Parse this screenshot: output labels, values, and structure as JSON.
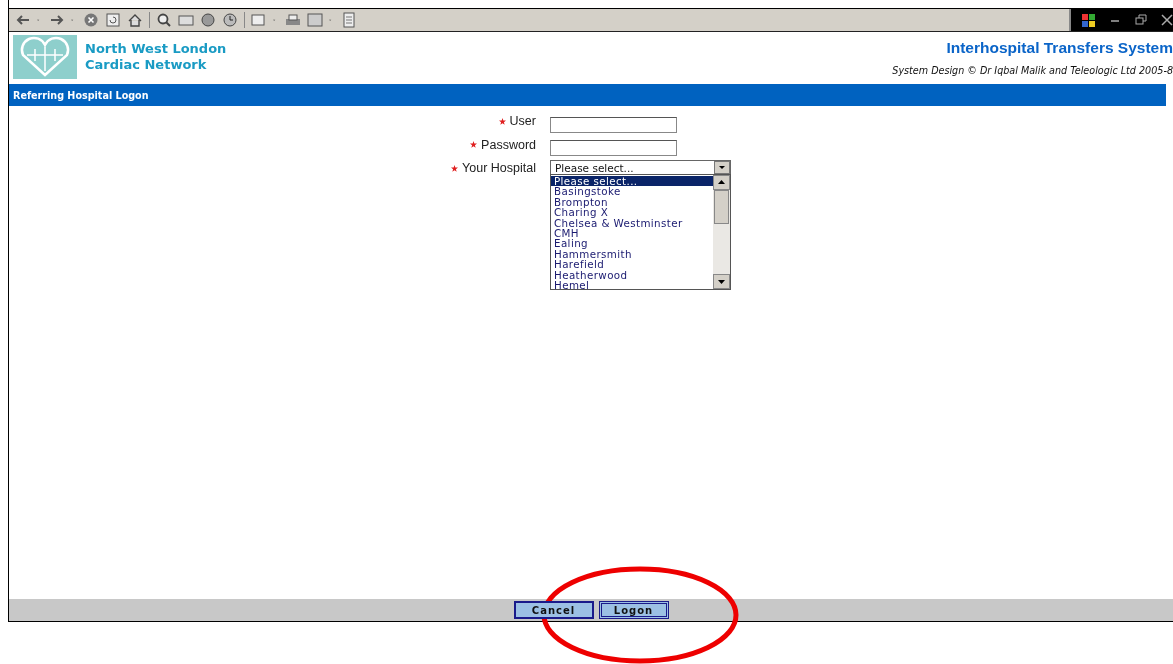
{
  "header": {
    "network_name": [
      "North West London",
      "Cardiac Network"
    ],
    "system_title": "Interhospital Transfers System",
    "copyright": "System Design © Dr Iqbal Malik and Teleologic Ltd 2005-8"
  },
  "title_bar": "Referring Hospital Logon",
  "fields": [
    {
      "kind": "text",
      "label": "User",
      "required": true
    },
    {
      "kind": "text",
      "label": "Password",
      "required": true
    },
    {
      "kind": "select",
      "label": "Your Hospital",
      "required": true,
      "value": "Please select...",
      "expanded": true,
      "options": [
        {
          "label": "Please select...",
          "selected": true
        },
        {
          "label": "Basingstoke",
          "selected": false
        },
        {
          "label": "Brompton",
          "selected": false
        },
        {
          "label": "Charing X",
          "selected": false
        },
        {
          "label": "Chelsea & Westminster",
          "selected": false
        },
        {
          "label": "CMH",
          "selected": false
        },
        {
          "label": "Ealing",
          "selected": false
        },
        {
          "label": "Hammersmith",
          "selected": false
        },
        {
          "label": "Harefield",
          "selected": false
        },
        {
          "label": "Heatherwood",
          "selected": false
        },
        {
          "label": "Hemel",
          "selected": false
        }
      ]
    }
  ],
  "buttons": [
    {
      "label": "Cancel",
      "default": false
    },
    {
      "label": "Logon",
      "default": true
    }
  ],
  "annotation": {
    "kind": "ellipse",
    "color": "#ee0000"
  }
}
